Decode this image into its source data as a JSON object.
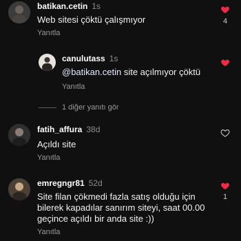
{
  "colors": {
    "like_active": "#ed2b45",
    "background": "#101010",
    "muted": "#9a9a9a"
  },
  "comments": [
    {
      "username": "batikan.cetin",
      "time": "1s",
      "text": "Web sitesi çöktü çalışmıyor",
      "reply_label": "Yanıtla",
      "likes": "4",
      "liked": true,
      "avatar_icon": "avatar-photo"
    },
    {
      "username": "canulutass",
      "time": "1s",
      "mention": "@batikan.cetin",
      "text": " site açılmıyor çöktü",
      "reply_label": "Yanıtla",
      "likes": "",
      "liked": true,
      "avatar_icon": "avatar-photo"
    },
    {
      "username": "fatih_affura",
      "time": "38d",
      "text": "Açıldı site",
      "reply_label": "Yanıtla",
      "likes": "",
      "liked": false,
      "avatar_icon": "avatar-photo"
    },
    {
      "username": "emregngr81",
      "time": "52d",
      "text": "Site filan çökmedi fazla satış olduğu için bilerek kapadılar sanırım siteyi, saat 00.00 geçince açıldı bir anda site :))",
      "reply_label": "Yanıtla",
      "likes": "1",
      "liked": true,
      "avatar_icon": "avatar-photo"
    }
  ],
  "view_more_replies": "1 diğer yanıtı gör"
}
